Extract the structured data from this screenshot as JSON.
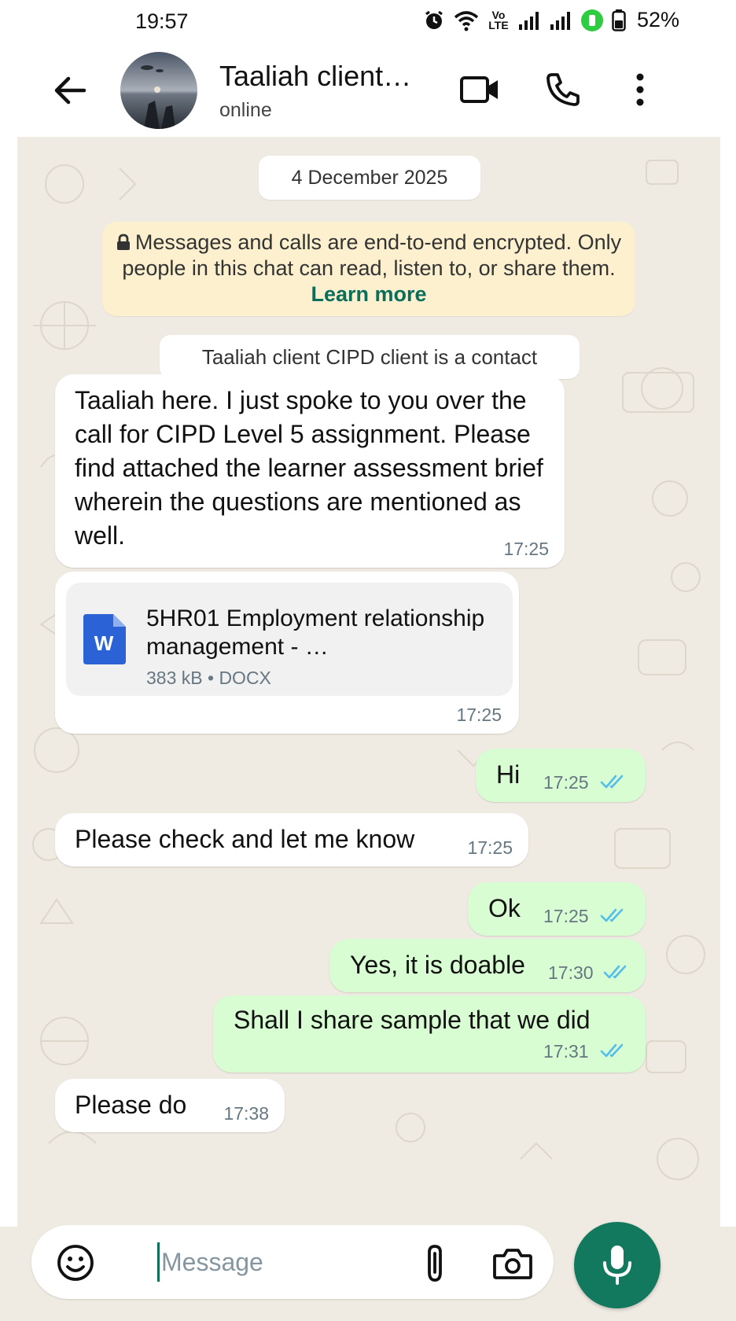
{
  "status_bar": {
    "time": "19:57",
    "network_label": "Vo LTE",
    "battery_percent": "52%",
    "battery_level": 0.52
  },
  "header": {
    "contact_name": "Taaliah client…",
    "contact_status": "online",
    "icons": [
      "back-arrow-icon",
      "video-call-icon",
      "voice-call-icon",
      "more-options-icon"
    ]
  },
  "chat": {
    "date_label": "4 December 2025",
    "encryption_notice": {
      "text": "Messages and calls are end-to-end encrypted. Only people in this chat can read, listen to, or share them.",
      "link": "Learn more"
    },
    "contact_notice": "Taaliah client CIPD client is a contact",
    "messages": [
      {
        "direction": "in",
        "text": "Taaliah here. I just spoke to you over the call for CIPD Level 5 assignment. Please find attached the learner assessment brief wherein the questions are mentioned as well.",
        "time": "17:25"
      },
      {
        "direction": "in",
        "type": "document",
        "file_name": "5HR01 Employment relationship management - …",
        "file_meta": "383 kB • DOCX",
        "file_icon": "W",
        "time": "17:25"
      },
      {
        "direction": "out",
        "text": "Hi",
        "time": "17:25",
        "status": "read"
      },
      {
        "direction": "in",
        "text": "Please check and let me know",
        "time": "17:25"
      },
      {
        "direction": "out",
        "text": "Ok",
        "time": "17:25",
        "status": "read"
      },
      {
        "direction": "out",
        "text": "Yes, it is doable",
        "time": "17:30",
        "status": "read"
      },
      {
        "direction": "out",
        "text": "Shall I share sample that we did",
        "time": "17:31",
        "status": "read"
      },
      {
        "direction": "in",
        "text": "Please do",
        "time": "17:38"
      }
    ]
  },
  "composer": {
    "placeholder": "Message",
    "icons": [
      "emoji-icon",
      "attach-icon",
      "camera-icon",
      "mic-icon"
    ]
  },
  "colors": {
    "incoming_bubble": "#ffffff",
    "outgoing_bubble": "#d9fdd3",
    "chat_background": "#efeae2",
    "accent": "#13795e",
    "read_ticks": "#53bdeb",
    "encryption_banner": "#fdf0cf"
  }
}
